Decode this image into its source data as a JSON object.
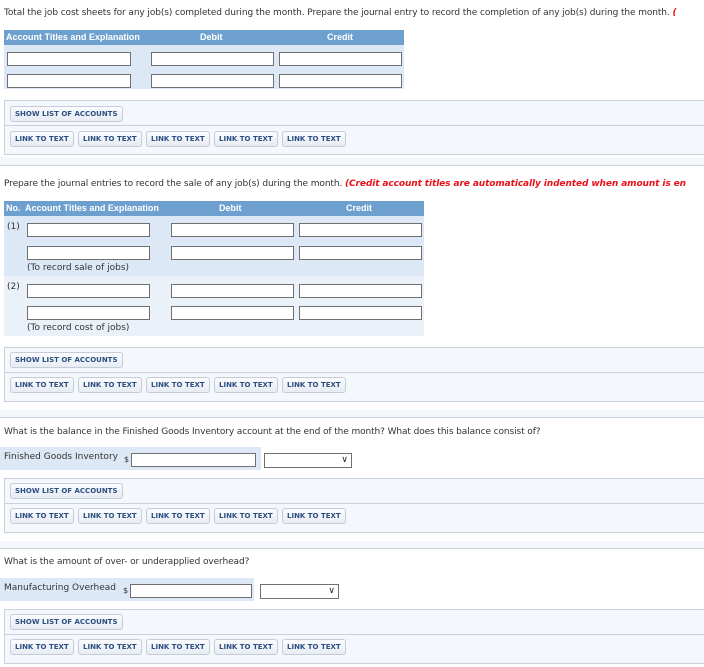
{
  "section1": {
    "instruction": "Total the job cost sheets for any job(s) completed during the month. Prepare the journal entry to record the completion of any job(s) during the month.",
    "instruction_note": "(",
    "table_headers": {
      "account": "Account Titles and Explanation",
      "debit": "Debit",
      "credit": "Credit"
    },
    "rows": [
      {
        "account": "",
        "debit": "",
        "credit": ""
      },
      {
        "account": "",
        "debit": "",
        "credit": ""
      }
    ]
  },
  "section2": {
    "instruction": "Prepare the journal entries to record the sale of any job(s) during the month.",
    "instruction_note": "(Credit account titles are automatically indented when amount is en",
    "table_headers": {
      "no": "No.",
      "account": "Account Titles and Explanation",
      "debit": "Debit",
      "credit": "Credit"
    },
    "entries": [
      {
        "no": "(1)",
        "memo": "(To record sale of jobs)",
        "rows": [
          {
            "account": "",
            "debit": "",
            "credit": ""
          },
          {
            "account": "",
            "debit": "",
            "credit": ""
          }
        ]
      },
      {
        "no": "(2)",
        "memo": "(To record cost of jobs)",
        "rows": [
          {
            "account": "",
            "debit": "",
            "credit": ""
          },
          {
            "account": "",
            "debit": "",
            "credit": ""
          }
        ]
      }
    ]
  },
  "section3": {
    "question": "What is the balance in the Finished Goods Inventory account at the end of the month? What does this balance consist of?",
    "label": "Finished Goods Inventory",
    "currency": "$",
    "amount": "",
    "select_value": ""
  },
  "section4": {
    "question": "What is the amount of over- or underapplied overhead?",
    "label": "Manufacturing Overhead",
    "currency": "$",
    "amount": "",
    "select_value": ""
  },
  "tools": {
    "show_accounts": "SHOW LIST OF ACCOUNTS",
    "link_to_text": [
      "LINK TO TEXT",
      "LINK TO TEXT",
      "LINK TO TEXT",
      "LINK TO TEXT",
      "LINK TO TEXT"
    ]
  },
  "icons": {
    "select_chevron": "chevron-down-icon"
  }
}
